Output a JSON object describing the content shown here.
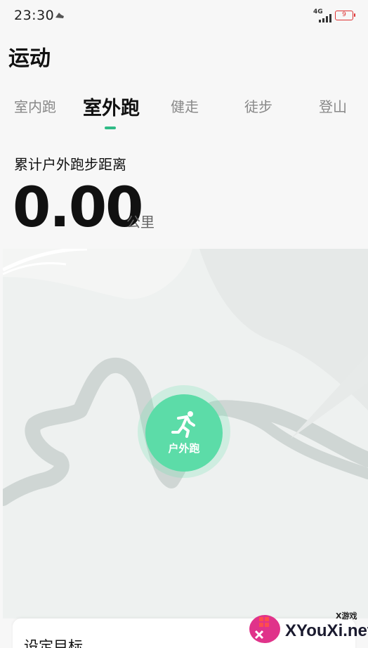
{
  "status_bar": {
    "time": "23:30",
    "network": "4G",
    "battery": "9",
    "battery_color": "#dd3333"
  },
  "page": {
    "title": "运动"
  },
  "tabs": [
    {
      "label": "室内跑",
      "active": false
    },
    {
      "label": "室外跑",
      "active": true
    },
    {
      "label": "健走",
      "active": false
    },
    {
      "label": "徒步",
      "active": false
    },
    {
      "label": "登山",
      "active": false
    }
  ],
  "stats": {
    "label": "累计户外跑步距离",
    "value": "0.00",
    "unit": "公里"
  },
  "map": {
    "start_label": "户外跑",
    "start_icon": "running-person-icon"
  },
  "goal_card": {
    "title": "设定目标"
  },
  "watermark": {
    "brand": "XYouXi.net",
    "small": "X游戏"
  },
  "colors": {
    "accent": "#2fbb86",
    "start_button": "#5cdca8",
    "map_bg": "#eef1f0",
    "river": "#cfd6d4"
  }
}
